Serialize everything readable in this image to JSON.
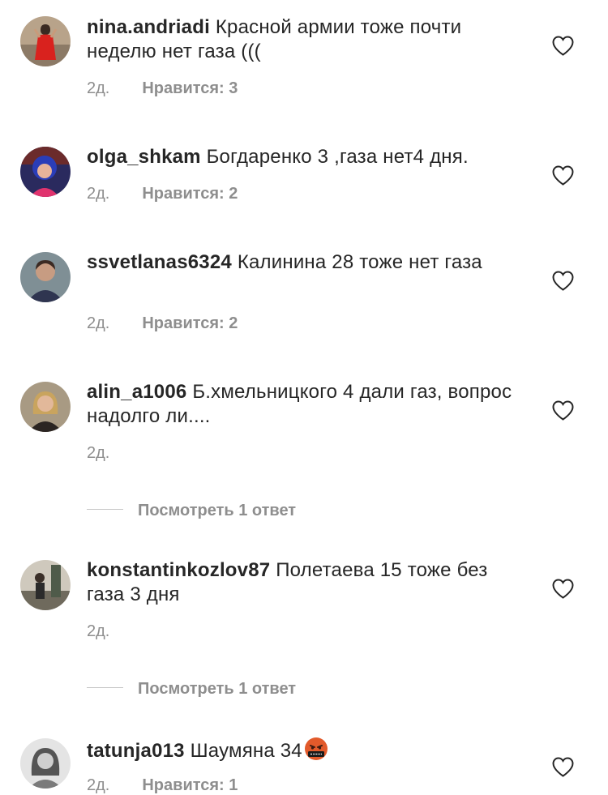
{
  "comments": [
    {
      "username": "nina.andriadi",
      "text": "Красной армии тоже почти неделю нет газа (((",
      "time": "2д.",
      "likes": "Нравится: 3",
      "avatar_icon": "user-photo-red-dress",
      "replies": ""
    },
    {
      "username": "olga_shkam",
      "text": "Богдаренко 3 ,газа нет4 дня.",
      "time": "2д.",
      "likes": "Нравится: 2",
      "avatar_icon": "user-photo-blue-hair",
      "replies": ""
    },
    {
      "username": "ssvetlanas6324",
      "text": "Калинина 28 тоже нет газа",
      "time": "2д.",
      "likes": "Нравится: 2",
      "avatar_icon": "user-photo-portrait",
      "replies": ""
    },
    {
      "username": "alin_a1006",
      "text": "Б.хмельницкого 4 дали газ, вопрос надолго ли....",
      "time": "2д.",
      "likes": "",
      "avatar_icon": "user-photo-blonde",
      "replies": "Посмотреть 1 ответ"
    },
    {
      "username": "konstantinkozlov87",
      "text": "Полетаева 15 тоже без газа 3 дня",
      "time": "2д.",
      "likes": "",
      "avatar_icon": "user-photo-outdoor",
      "replies": "Посмотреть 1 ответ"
    },
    {
      "username": "tatunja013",
      "text": "Шаумяна 34",
      "time": "2д.",
      "likes": "Нравится: 1",
      "avatar_icon": "user-photo-bw",
      "replies": "",
      "emoji": "cursing-face-emoji"
    }
  ],
  "colors": {
    "text": "#262626",
    "secondary": "#8e8e8e",
    "divider": "#c7c7c7",
    "heart_stroke": "#262626"
  }
}
